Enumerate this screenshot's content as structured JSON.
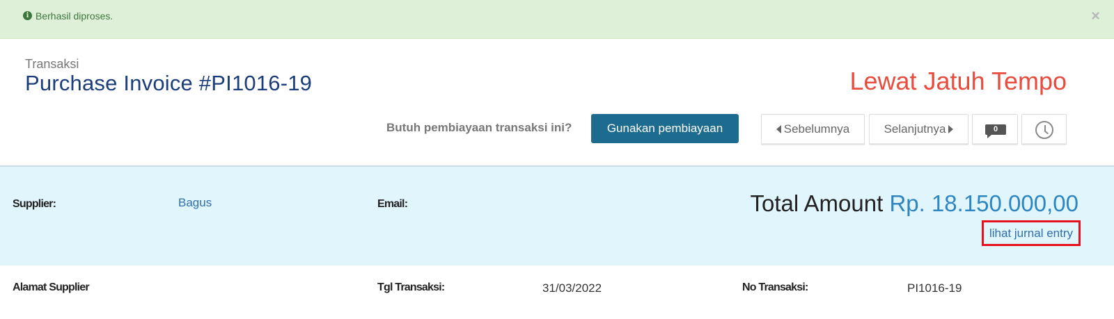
{
  "alert": {
    "icon": "info-circle-icon",
    "message": "Berhasil diproses.",
    "close": "×"
  },
  "header": {
    "breadcrumb": "Transaksi",
    "title": "Purchase Invoice #PI1016-19",
    "status": "Lewat Jatuh Tempo"
  },
  "toolbar": {
    "financing_question": "Butuh pembiayaan transaksi ini?",
    "financing_button": "Gunakan pembiayaan",
    "prev_label": "Sebelumnya",
    "next_label": "Selanjutnya",
    "comment_count": "0"
  },
  "summary": {
    "supplier_label": "Supplier:",
    "supplier_value": "Bagus",
    "email_label": "Email:",
    "total_label": "Total Amount",
    "total_value": "Rp. 18.150.000,00",
    "journal_link": "lihat jurnal entry"
  },
  "details": {
    "address_label": "Alamat Supplier",
    "date_label": "Tgl Transaksi:",
    "date_value": "31/03/2022",
    "number_label": "No Transaksi:",
    "number_value": "PI1016-19"
  },
  "colors": {
    "status": "#e74c3c",
    "primary_button": "#1d6b8f",
    "title": "#1b3d7a",
    "alert_bg": "#dff0d8",
    "summary_bg": "#e1f5fd",
    "highlight": "#e8101c"
  }
}
